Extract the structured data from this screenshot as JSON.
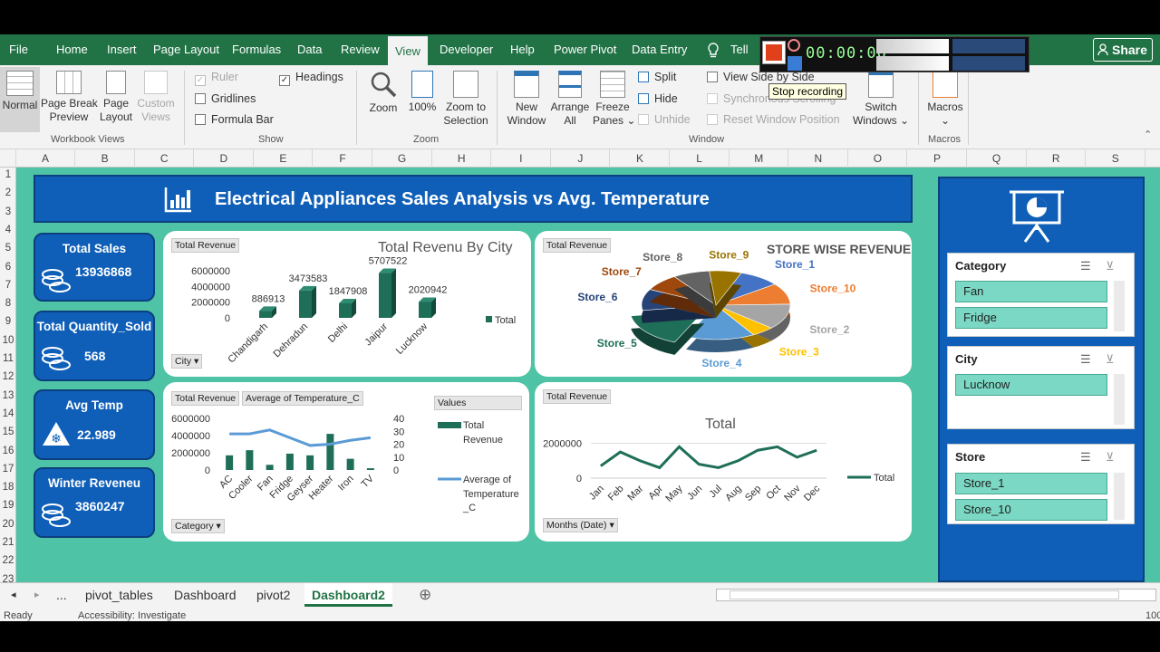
{
  "ribbon_tabs": [
    "File",
    "Home",
    "Insert",
    "Page Layout",
    "Formulas",
    "Data",
    "Review",
    "View",
    "Developer",
    "Help",
    "Power Pivot",
    "Data Entry",
    "Tell"
  ],
  "active_tab": "View",
  "share_label": "Share",
  "ribbon": {
    "workbook_views": {
      "normal": "Normal",
      "page_break": "Page Break",
      "page_break2": "Preview",
      "page_layout": "Page",
      "page_layout2": "Layout",
      "custom": "Custom",
      "custom2": "Views",
      "group": "Workbook Views"
    },
    "show": {
      "ruler": "Ruler",
      "gridlines": "Gridlines",
      "formula_bar": "Formula Bar",
      "headings": "Headings",
      "group": "Show"
    },
    "zoom": {
      "zoom": "Zoom",
      "zoom100": "100%",
      "zoom_sel": "Zoom to",
      "zoom_sel2": "Selection",
      "group": "Zoom"
    },
    "window": {
      "new": "New",
      "new2": "Window",
      "arrange": "Arrange",
      "arrange2": "All",
      "freeze": "Freeze",
      "freeze2": "Panes",
      "split": "Split",
      "hide": "Hide",
      "unhide": "Unhide",
      "side": "View Side by Side",
      "sync": "Synchronous Scrolling",
      "reset": "Reset Window Position",
      "switch": "Switch",
      "switch2": "Windows",
      "group": "Window"
    },
    "macros": {
      "macros": "Macros",
      "group": "Macros"
    }
  },
  "recorder_tooltip": "Stop recording",
  "recorder_time": "00:00:00",
  "columns": [
    "A",
    "B",
    "C",
    "D",
    "E",
    "F",
    "G",
    "H",
    "I",
    "J",
    "K",
    "L",
    "M",
    "N",
    "O",
    "P",
    "Q",
    "R",
    "S"
  ],
  "rows": [
    "1",
    "2",
    "3",
    "4",
    "5",
    "6",
    "7",
    "8",
    "9",
    "10",
    "11",
    "12",
    "13",
    "14",
    "15",
    "16",
    "17",
    "18",
    "19",
    "20",
    "21",
    "22",
    "23"
  ],
  "dashboard_title": "Electrical Appliances Sales Analysis vs Avg. Temperature",
  "kpis": [
    {
      "label": "Total Sales",
      "value": "13936868"
    },
    {
      "label": "Total Quantity_Sold",
      "value": "568"
    },
    {
      "label": "Avg Temp",
      "value": "22.989"
    },
    {
      "label": "Winter Reveneu",
      "value": "3860247"
    }
  ],
  "pivot_buttons": {
    "c1_value": "Total Revenue",
    "c1_axis": "City",
    "c2_value": "Total Revenue",
    "c3_value1": "Total Revenue",
    "c3_value2": "Average of Temperature_C",
    "c3_axis": "Category",
    "c3_values": "Values",
    "c4_value": "Total Revenue",
    "c4_axis": "Months (Date)"
  },
  "chart_data": [
    {
      "type": "bar",
      "title": "Total Revenu By City",
      "categories": [
        "Chandigarh",
        "Dehradun",
        "Delhi",
        "Jaipur",
        "Lucknow"
      ],
      "series": [
        {
          "name": "Total",
          "values": [
            886913,
            3473583,
            1847908,
            5707522,
            2020942
          ]
        }
      ],
      "yticks": [
        "6000000",
        "4000000",
        "2000000",
        "0"
      ],
      "ylim": [
        0,
        6000000
      ],
      "legend": "right",
      "color": "#1e6e58"
    },
    {
      "type": "pie",
      "title": "STORE WISE REVENUE",
      "labels": [
        "Store_1",
        "Store_10",
        "Store_2",
        "Store_3",
        "Store_4",
        "Store_5",
        "Store_6",
        "Store_7",
        "Store_8",
        "Store_9"
      ],
      "values": [
        9,
        10,
        12,
        5,
        15,
        16,
        10,
        8,
        8,
        7
      ],
      "colors": [
        "#4472c4",
        "#ed7d31",
        "#a5a5a5",
        "#ffc000",
        "#5b9bd5",
        "#1e6e58",
        "#264478",
        "#9e480e",
        "#636363",
        "#997300"
      ]
    },
    {
      "type": "bar",
      "title": "",
      "categories": [
        "AC",
        "Cooler",
        "Fan",
        "Fridge",
        "Geyser",
        "Heater",
        "Iron",
        "TV"
      ],
      "series": [
        {
          "name": "Total Revenue",
          "values": [
            1700000,
            2300000,
            600000,
            1900000,
            1700000,
            4200000,
            1300000,
            200000
          ]
        },
        {
          "name": "Average of Temperature_C",
          "values": [
            28,
            28,
            31,
            25,
            19,
            20,
            23,
            25
          ]
        }
      ],
      "yticks": [
        "6000000",
        "4000000",
        "2000000",
        "0"
      ],
      "y2ticks": [
        "40",
        "30",
        "20",
        "10",
        "0"
      ],
      "ylim": [
        0,
        6000000
      ],
      "y2lim": [
        0,
        40
      ],
      "legend": "right",
      "legend_labels": [
        "Total",
        "Revenue",
        "Average of",
        "Temperature",
        "_C"
      ]
    },
    {
      "type": "line",
      "title": "Total",
      "categories": [
        "Jan",
        "Feb",
        "Mar",
        "Apr",
        "May",
        "Jun",
        "Jul",
        "Aug",
        "Sep",
        "Oct",
        "Nov",
        "Dec"
      ],
      "series": [
        {
          "name": "Total",
          "values": [
            700000,
            1500000,
            1000000,
            600000,
            1800000,
            800000,
            600000,
            1000000,
            1600000,
            1800000,
            1200000,
            1600000
          ]
        }
      ],
      "yticks": [
        "2000000",
        "0"
      ],
      "ylim": [
        0,
        2600000
      ],
      "legend": "right",
      "color": "#1e6e58"
    }
  ],
  "slicers": [
    {
      "header": "Category",
      "items": [
        "Fan",
        "Fridge"
      ]
    },
    {
      "header": "City",
      "items": [
        "Lucknow"
      ]
    },
    {
      "header": "Store",
      "items": [
        "Store_1",
        "Store_10"
      ]
    }
  ],
  "sheet_tabs": [
    "...",
    "pivot_tables",
    "Dashboard",
    "pivot2",
    "Dashboard2"
  ],
  "active_sheet": "Dashboard2",
  "status": {
    "ready": "Ready",
    "accessibility": "Accessibility: Investigate",
    "zoom": "100"
  }
}
